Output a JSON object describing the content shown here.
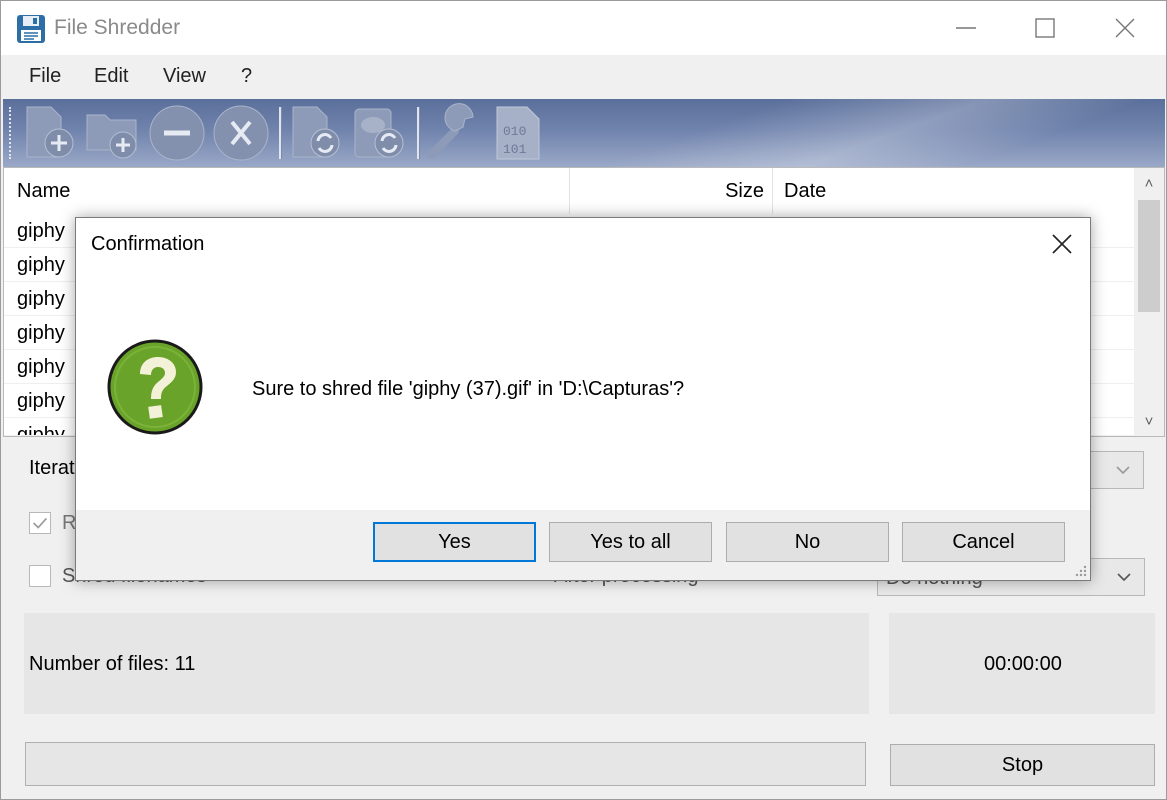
{
  "window": {
    "title": "File Shredder",
    "app_icon": "floppy-disk-icon"
  },
  "window_controls": [
    "minimize-icon",
    "maximize-icon",
    "close-icon"
  ],
  "menu": [
    "File",
    "Edit",
    "View",
    "?"
  ],
  "toolbar": {
    "buttons": [
      "add-file-icon",
      "add-folder-icon",
      "remove-icon",
      "clear-icon",
      "shred-file-icon",
      "shred-disk-icon",
      "settings-wrench-icon",
      "binary-icon"
    ]
  },
  "file_list": {
    "columns": {
      "name": "Name",
      "size": "Size",
      "date": "Date"
    },
    "rows": [
      "giphy",
      "giphy",
      "giphy",
      "giphy",
      "giphy",
      "giphy",
      "giphy"
    ]
  },
  "options": {
    "iterations_label": "Iterat",
    "checkbox1_label": "R",
    "checkbox1_checked": true,
    "shred_filenames_label": "Shred filenames",
    "after_processing_label": "After processing",
    "after_processing_value": "Do nothing"
  },
  "status": {
    "number_of_files": "Number of files: 11",
    "timer": "00:00:00"
  },
  "stop_label": "Stop",
  "dialog": {
    "title": "Confirmation",
    "message": "Sure to shred file 'giphy (37).gif' in 'D:\\Capturas'?",
    "icon": "question-icon",
    "icon_color": "#6aa329",
    "buttons": {
      "yes": "Yes",
      "yes_to_all": "Yes to all",
      "no": "No",
      "cancel": "Cancel"
    }
  }
}
